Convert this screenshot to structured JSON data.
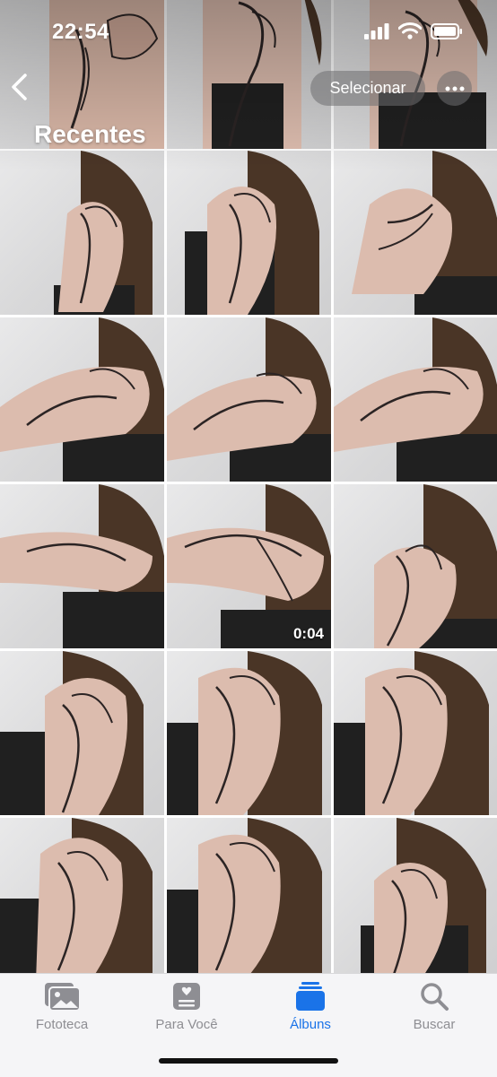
{
  "status_bar": {
    "time": "22:54"
  },
  "header": {
    "title": "Recentes",
    "select_label": "Selecionar"
  },
  "grid": {
    "video_duration": "0:04"
  },
  "tabbar": {
    "items": [
      {
        "label": "Fototeca"
      },
      {
        "label": "Para Você"
      },
      {
        "label": "Álbuns"
      },
      {
        "label": "Buscar"
      }
    ]
  },
  "colors": {
    "accent": "#1a73e8"
  }
}
